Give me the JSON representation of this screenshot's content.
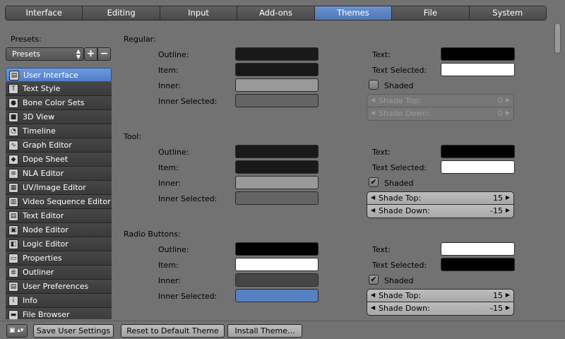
{
  "tabs": [
    {
      "label": "Interface",
      "active": false
    },
    {
      "label": "Editing",
      "active": false
    },
    {
      "label": "Input",
      "active": false
    },
    {
      "label": "Add-ons",
      "active": false
    },
    {
      "label": "Themes",
      "active": true
    },
    {
      "label": "File",
      "active": false
    },
    {
      "label": "System",
      "active": false
    }
  ],
  "left": {
    "presets_label": "Presets:",
    "presets_value": "Presets",
    "add_label": "+",
    "remove_label": "−",
    "items": [
      {
        "label": "User Interface",
        "icon": "user-interface-icon",
        "active": true
      },
      {
        "label": "Text Style",
        "icon": "text-style-icon"
      },
      {
        "label": "Bone Color Sets",
        "icon": "bone-color-sets-icon"
      },
      {
        "label": "3D View",
        "icon": "3d-view-icon"
      },
      {
        "label": "Timeline",
        "icon": "timeline-icon"
      },
      {
        "label": "Graph Editor",
        "icon": "graph-editor-icon"
      },
      {
        "label": "Dope Sheet",
        "icon": "dope-sheet-icon"
      },
      {
        "label": "NLA Editor",
        "icon": "nla-editor-icon"
      },
      {
        "label": "UV/Image Editor",
        "icon": "uv-image-editor-icon"
      },
      {
        "label": "Video Sequence Editor",
        "icon": "video-sequence-editor-icon"
      },
      {
        "label": "Text Editor",
        "icon": "text-editor-icon"
      },
      {
        "label": "Node Editor",
        "icon": "node-editor-icon"
      },
      {
        "label": "Logic Editor",
        "icon": "logic-editor-icon"
      },
      {
        "label": "Properties",
        "icon": "properties-icon"
      },
      {
        "label": "Outliner",
        "icon": "outliner-icon"
      },
      {
        "label": "User Preferences",
        "icon": "user-preferences-icon"
      },
      {
        "label": "Info",
        "icon": "info-icon"
      },
      {
        "label": "File Browser",
        "icon": "file-browser-icon"
      }
    ]
  },
  "labels": {
    "outline": "Outline:",
    "item": "Item:",
    "inner": "Inner:",
    "inner_selected": "Inner Selected:",
    "text": "Text:",
    "text_selected": "Text Selected:",
    "shaded": "Shaded",
    "shade_top": "Shade Top:",
    "shade_down": "Shade Down:"
  },
  "sections": [
    {
      "title": "Regular:",
      "colors": {
        "outline": "#191919",
        "item": "#191919",
        "inner": "#999999",
        "inner_selected": "#646464",
        "text": "#000000",
        "text_selected": "#ffffff"
      },
      "shaded": false,
      "shade_top": "0",
      "shade_down": "0"
    },
    {
      "title": "Tool:",
      "colors": {
        "outline": "#191919",
        "item": "#191919",
        "inner": "#999999",
        "inner_selected": "#646464",
        "text": "#000000",
        "text_selected": "#ffffff"
      },
      "shaded": true,
      "shade_top": "15",
      "shade_down": "-15"
    },
    {
      "title": "Radio Buttons:",
      "colors": {
        "outline": "#000000",
        "item": "#ffffff",
        "inner": "#464646",
        "inner_selected": "#5680c2",
        "text": "#ffffff",
        "text_selected": "#000000"
      },
      "shaded": true,
      "shade_top": "15",
      "shade_down": "-15"
    }
  ],
  "bottom": {
    "editor_icon": "preferences-editor-icon",
    "save": "Save User Settings",
    "reset": "Reset to Default Theme",
    "install": "Install Theme..."
  }
}
